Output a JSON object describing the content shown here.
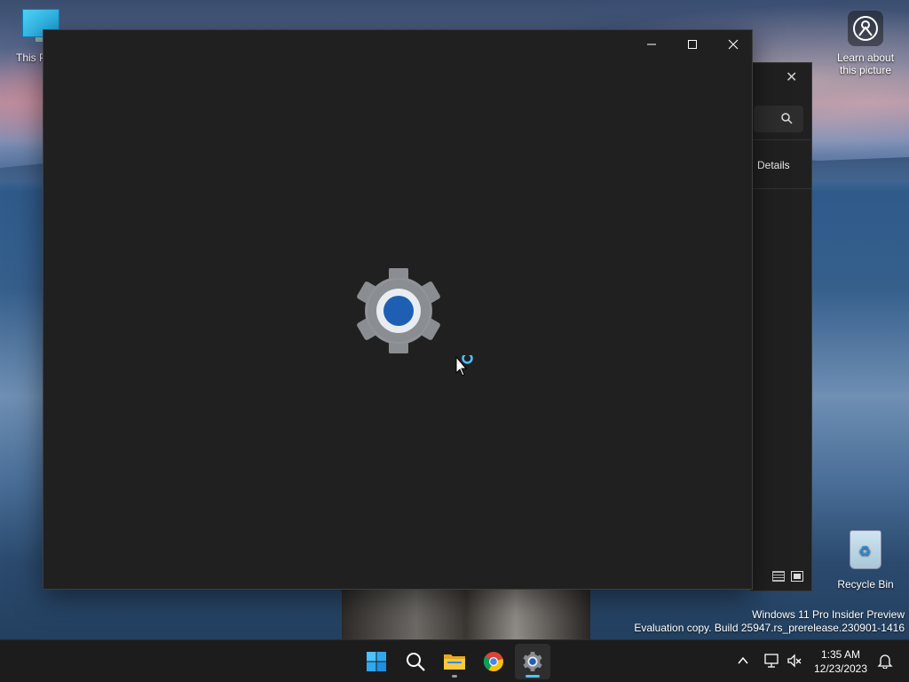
{
  "desktop": {
    "icons": {
      "this_pc": "This PC",
      "learn": "Learn about this picture",
      "recycle_bin": "Recycle Bin"
    },
    "watermark": {
      "line1": "Windows 11 Pro Insider Preview",
      "line2": "Evaluation copy. Build 25947.rs_prerelease.230901-1416"
    }
  },
  "background_window": {
    "details_label": "Details",
    "icons": [
      "close-icon",
      "search-icon",
      "details-view-icon",
      "tiles-view-icon"
    ]
  },
  "main_window": {
    "app": "Settings",
    "state": "loading",
    "caption_icons": [
      "minimize-icon",
      "maximize-icon",
      "close-icon"
    ]
  },
  "taskbar": {
    "pinned": [
      "start-icon",
      "search-icon",
      "file-explorer-icon",
      "chrome-icon",
      "settings-icon"
    ],
    "active_app": "settings",
    "clock": {
      "time": "1:35 AM",
      "date": "12/23/2023"
    }
  },
  "colors": {
    "accent": "#4cc2ff",
    "window_bg": "#202020",
    "taskbar_bg": "#1c1c1c",
    "gear_blue": "#1f5fb3",
    "gear_gray": "#8a8d92"
  }
}
